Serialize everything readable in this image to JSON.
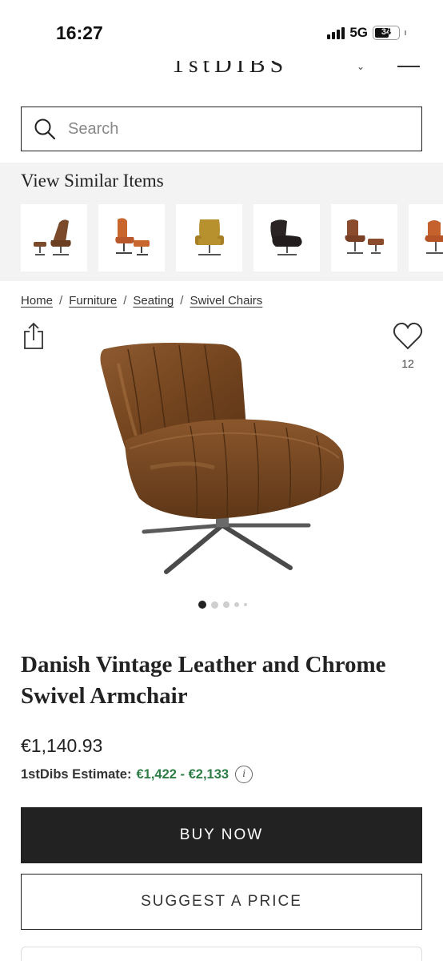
{
  "status_bar": {
    "time": "16:27",
    "network": "5G",
    "battery": "34"
  },
  "header": {
    "logo_partial": "1stDIBS"
  },
  "search": {
    "placeholder": "Search",
    "value": ""
  },
  "similar": {
    "title": "View Similar Items",
    "items": [
      {
        "icon": "swivel-lounge-chair-ottoman-icon",
        "color": "#7a4a2a"
      },
      {
        "icon": "orange-lounge-chair-ottoman-icon",
        "color": "#c8662e"
      },
      {
        "icon": "mustard-swivel-chair-icon",
        "color": "#b8912f"
      },
      {
        "icon": "black-swivel-chair-icon",
        "color": "#2b2424"
      },
      {
        "icon": "brown-lounge-chair-ottoman-icon",
        "color": "#8a4c2c"
      },
      {
        "icon": "orange-lounge-chair-icon",
        "color": "#c4612c"
      }
    ]
  },
  "breadcrumb": {
    "items": [
      "Home",
      "Furniture",
      "Seating",
      "Swivel Chairs"
    ],
    "separator": "/"
  },
  "favorite": {
    "count": "12"
  },
  "gallery": {
    "image": "brown-leather-swivel-armchair-photo",
    "total_dots": 5,
    "active_index": 0
  },
  "product": {
    "title": "Danish Vintage Leather and Chrome Swivel Armchair",
    "price": "€1,140.93",
    "estimate_label": "1stDibs Estimate:",
    "estimate_range": "€1,422 - €2,133"
  },
  "actions": {
    "buy_now": "BUY NOW",
    "suggest_price": "SUGGEST A PRICE"
  },
  "colors": {
    "accent_green": "#2e7d46",
    "button_dark": "#222222",
    "leather": "#7b4a26"
  }
}
